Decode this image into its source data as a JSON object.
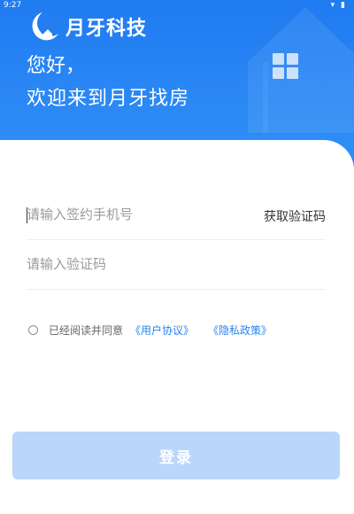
{
  "status_bar": {
    "time": "9:27",
    "icons": "▾ ▮"
  },
  "header": {
    "brand": "月牙科技",
    "greeting": "您好，",
    "welcome": "欢迎来到月牙找房"
  },
  "form": {
    "phone_placeholder": "请输入签约手机号",
    "code_placeholder": "请输入验证码",
    "get_code_label": "获取验证码"
  },
  "agreement": {
    "prefix": "已经阅读并同意",
    "user_agreement": "《用户协议》",
    "privacy_policy": "《隐私政策》"
  },
  "login_label": "登录",
  "colors": {
    "primary": "#2a87f4",
    "link": "#2a83ee",
    "button_disabled": "#b9d6fb"
  }
}
